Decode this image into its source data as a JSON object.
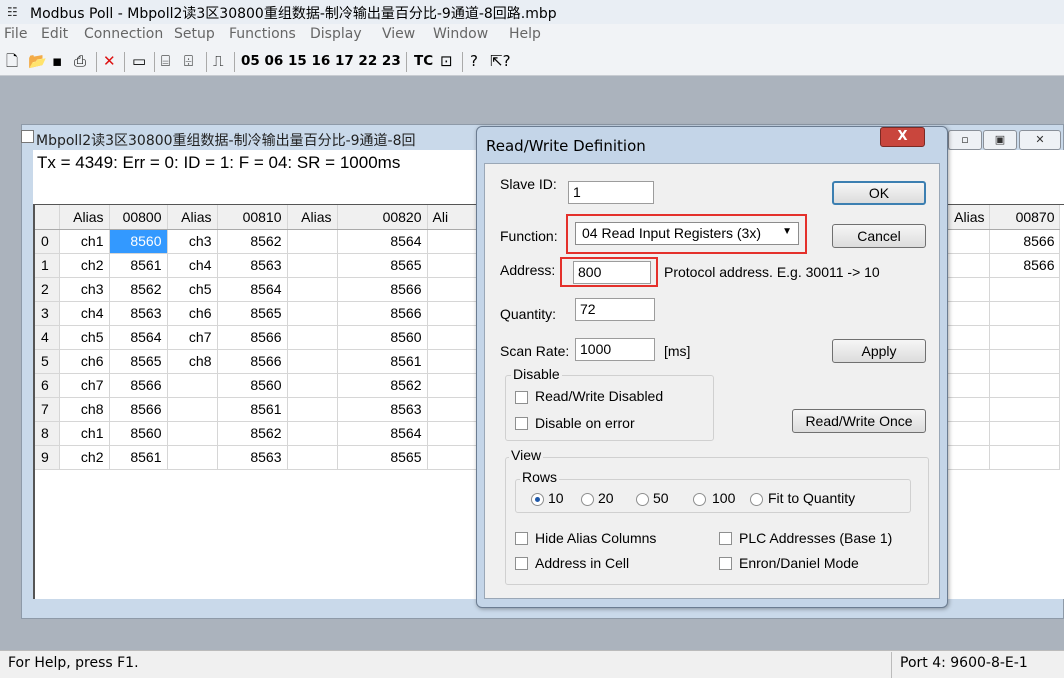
{
  "app": {
    "title": "Modbus Poll - Mbpoll2读3区30800重组数据-制冷输出量百分比-9通道-8回路.mbp"
  },
  "menu": [
    "File",
    "Edit",
    "Connection",
    "Setup",
    "Functions",
    "Display",
    "View",
    "Window",
    "Help"
  ],
  "toolbar": {
    "function_codes": "05 06 15 16 17 22 23",
    "tc_label": "TC"
  },
  "child_window": {
    "title": "Mbpoll2读3区30800重组数据-制冷输出量百分比-9通道-8回",
    "status": "Tx = 4349: Err = 0: ID = 1: F = 04: SR = 1000ms"
  },
  "grid": {
    "headers": [
      "Alias",
      "00800",
      "Alias",
      "00810",
      "Alias",
      "00820",
      "Ali"
    ],
    "rows": [
      {
        "idx": "0",
        "a1": "ch1",
        "v1": "8560",
        "a2": "ch3",
        "v2": "8562",
        "a3": "",
        "v3": "8564"
      },
      {
        "idx": "1",
        "a1": "ch2",
        "v1": "8561",
        "a2": "ch4",
        "v2": "8563",
        "a3": "",
        "v3": "8565"
      },
      {
        "idx": "2",
        "a1": "ch3",
        "v1": "8562",
        "a2": "ch5",
        "v2": "8564",
        "a3": "",
        "v3": "8566"
      },
      {
        "idx": "3",
        "a1": "ch4",
        "v1": "8563",
        "a2": "ch6",
        "v2": "8565",
        "a3": "",
        "v3": "8566"
      },
      {
        "idx": "4",
        "a1": "ch5",
        "v1": "8564",
        "a2": "ch7",
        "v2": "8566",
        "a3": "",
        "v3": "8560"
      },
      {
        "idx": "5",
        "a1": "ch6",
        "v1": "8565",
        "a2": "ch8",
        "v2": "8566",
        "a3": "",
        "v3": "8561"
      },
      {
        "idx": "6",
        "a1": "ch7",
        "v1": "8566",
        "a2": "",
        "v2": "8560",
        "a3": "",
        "v3": "8562"
      },
      {
        "idx": "7",
        "a1": "ch8",
        "v1": "8566",
        "a2": "",
        "v2": "8561",
        "a3": "",
        "v3": "8563"
      },
      {
        "idx": "8",
        "a1": "ch1",
        "v1": "8560",
        "a2": "",
        "v2": "8562",
        "a3": "",
        "v3": "8564"
      },
      {
        "idx": "9",
        "a1": "ch2",
        "v1": "8561",
        "a2": "",
        "v2": "8563",
        "a3": "",
        "v3": "8565"
      }
    ],
    "right_headers": [
      "Alias",
      "00870"
    ],
    "right_values": [
      "8566",
      "8566"
    ]
  },
  "dialog": {
    "title": "Read/Write Definition",
    "slave_id_label": "Slave ID:",
    "slave_id": "1",
    "function_label": "Function:",
    "function_value": "04 Read Input Registers (3x)",
    "address_label": "Address:",
    "address_value": "800",
    "address_hint": "Protocol address. E.g. 30011 -> 10",
    "quantity_label": "Quantity:",
    "quantity_value": "72",
    "scan_rate_label": "Scan Rate:",
    "scan_rate_value": "1000",
    "scan_rate_unit": "[ms]",
    "ok": "OK",
    "cancel": "Cancel",
    "apply": "Apply",
    "read_write_once": "Read/Write Once",
    "disable_group": "Disable",
    "rw_disabled": "Read/Write Disabled",
    "disable_on_error": "Disable on error",
    "view_group": "View",
    "rows_group": "Rows",
    "rows_options": [
      "10",
      "20",
      "50",
      "100",
      "Fit to Quantity"
    ],
    "hide_alias": "Hide Alias Columns",
    "plc_addresses": "PLC Addresses (Base 1)",
    "address_in_cell": "Address in Cell",
    "enron_mode": "Enron/Daniel Mode"
  },
  "statusbar": {
    "help": "For Help, press F1.",
    "port": "Port 4: 9600-8-E-1"
  }
}
